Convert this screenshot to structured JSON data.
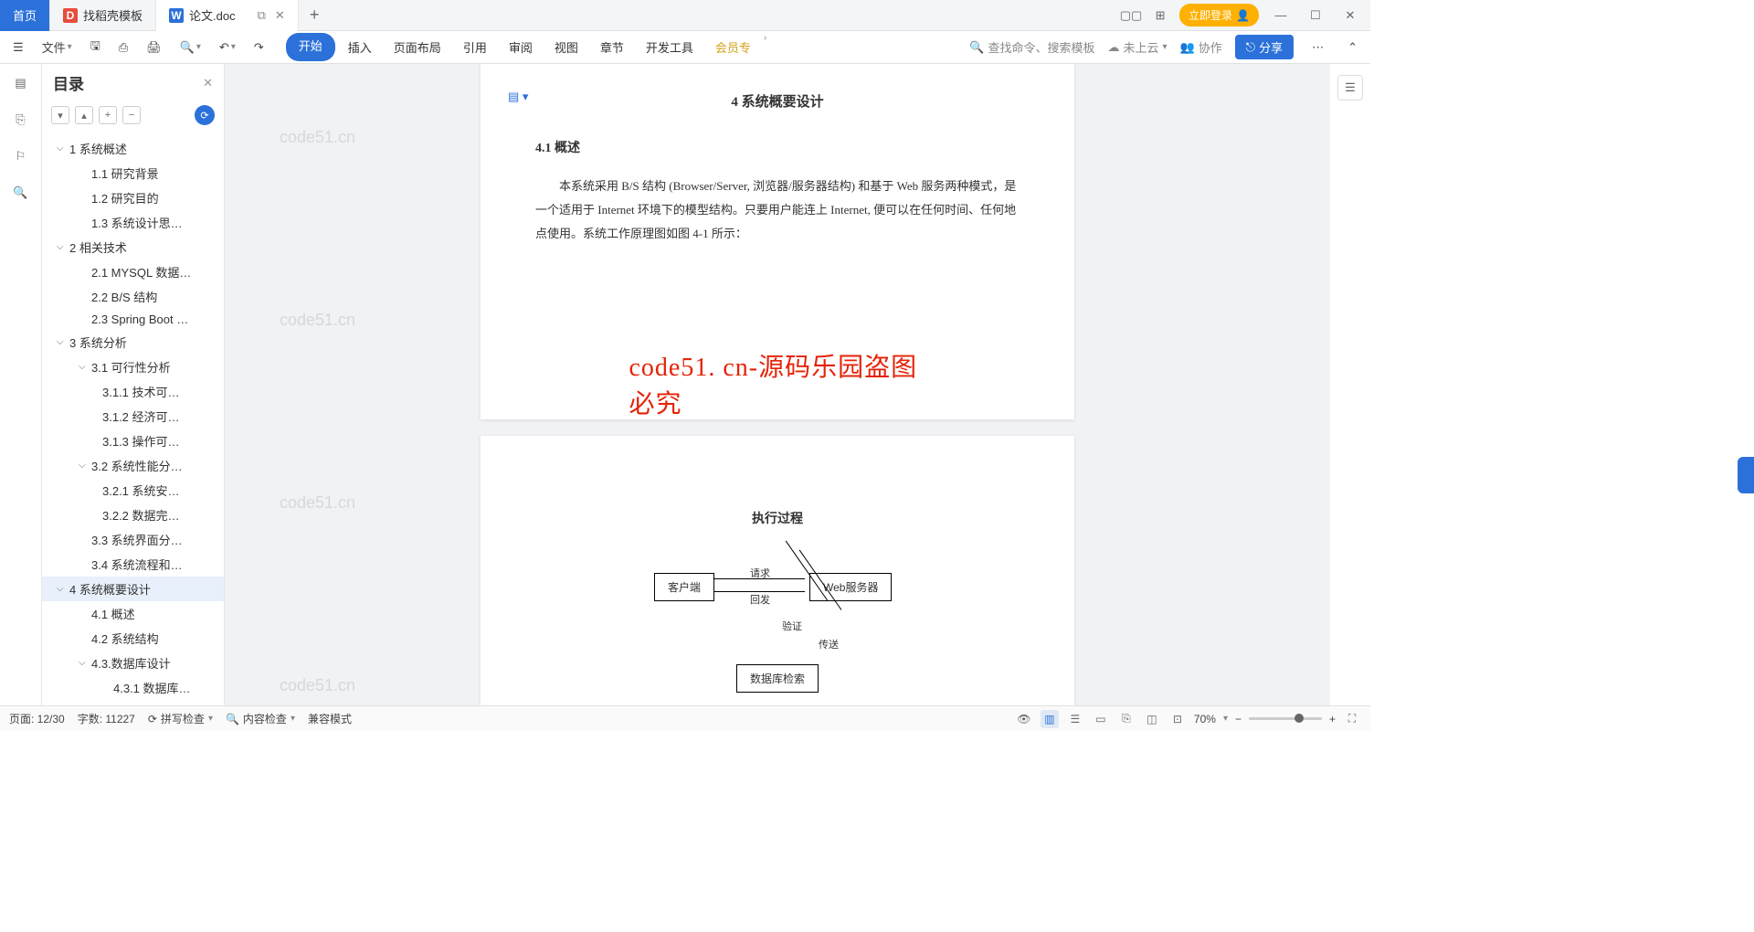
{
  "tabs": {
    "home": "首页",
    "template": "找稻壳模板",
    "doc": "论文.doc"
  },
  "login_btn": "立即登录",
  "toolbar": {
    "file": "文件",
    "menu": [
      "开始",
      "插入",
      "页面布局",
      "引用",
      "审阅",
      "视图",
      "章节",
      "开发工具",
      "会员专"
    ],
    "search_hint": "查找命令、搜索模板",
    "cloud": "未上云",
    "collab": "协作",
    "share": "分享"
  },
  "outline": {
    "title": "目录",
    "items": [
      {
        "lvl": 1,
        "caret": true,
        "label": "1 系统概述"
      },
      {
        "lvl": 2,
        "label": "1.1 研究背景"
      },
      {
        "lvl": 2,
        "label": "1.2 研究目的"
      },
      {
        "lvl": 2,
        "label": "1.3 系统设计思…"
      },
      {
        "lvl": 1,
        "caret": true,
        "label": "2 相关技术"
      },
      {
        "lvl": 2,
        "label": "2.1 MYSQL 数据…"
      },
      {
        "lvl": 2,
        "label": "2.2 B/S 结构"
      },
      {
        "lvl": 2,
        "label": "2.3 Spring Boot …"
      },
      {
        "lvl": 1,
        "caret": true,
        "label": "3 系统分析"
      },
      {
        "lvl": 2,
        "caret": true,
        "label": "3.1 可行性分析"
      },
      {
        "lvl": 3,
        "label": "3.1.1 技术可…"
      },
      {
        "lvl": 3,
        "label": "3.1.2 经济可…"
      },
      {
        "lvl": 3,
        "label": "3.1.3 操作可…"
      },
      {
        "lvl": 2,
        "caret": true,
        "label": "3.2 系统性能分…"
      },
      {
        "lvl": 3,
        "label": "3.2.1 系统安…"
      },
      {
        "lvl": 3,
        "label": "3.2.2 数据完…"
      },
      {
        "lvl": 2,
        "label": "3.3 系统界面分…"
      },
      {
        "lvl": 2,
        "label": "3.4 系统流程和…"
      },
      {
        "lvl": 1,
        "caret": true,
        "label": "4 系统概要设计",
        "sel": true
      },
      {
        "lvl": 2,
        "label": "4.1 概述"
      },
      {
        "lvl": 2,
        "label": "4.2 系统结构"
      },
      {
        "lvl": 2,
        "caret": true,
        "label": "4.3.数据库设计"
      },
      {
        "lvl": 4,
        "label": "4.3.1 数据库…"
      }
    ]
  },
  "doc": {
    "heading1": "4 系统概要设计",
    "heading2": "4.1 概述",
    "para": "本系统采用 B/S 结构 (Browser/Server, 浏览器/服务器结构) 和基于 Web 服务两种模式，是一个适用于 Internet 环境下的模型结构。只要用户能连上 Internet, 便可以在任何时间、任何地点使用。系统工作原理图如图 4-1 所示：",
    "watermark_red": "code51. cn-源码乐园盗图必究",
    "watermark_grey": "code51.cn",
    "diag_title": "执行过程",
    "diag": {
      "client": "客户端",
      "web": "Web服务器",
      "db": "数据库检索",
      "req": "请求",
      "resp": "回发",
      "verify": "验证",
      "send": "传送"
    }
  },
  "status": {
    "page": "页面: 12/30",
    "words": "字数: 11227",
    "spell": "拼写检查",
    "content": "内容检查",
    "compat": "兼容模式",
    "zoom": "70%"
  }
}
